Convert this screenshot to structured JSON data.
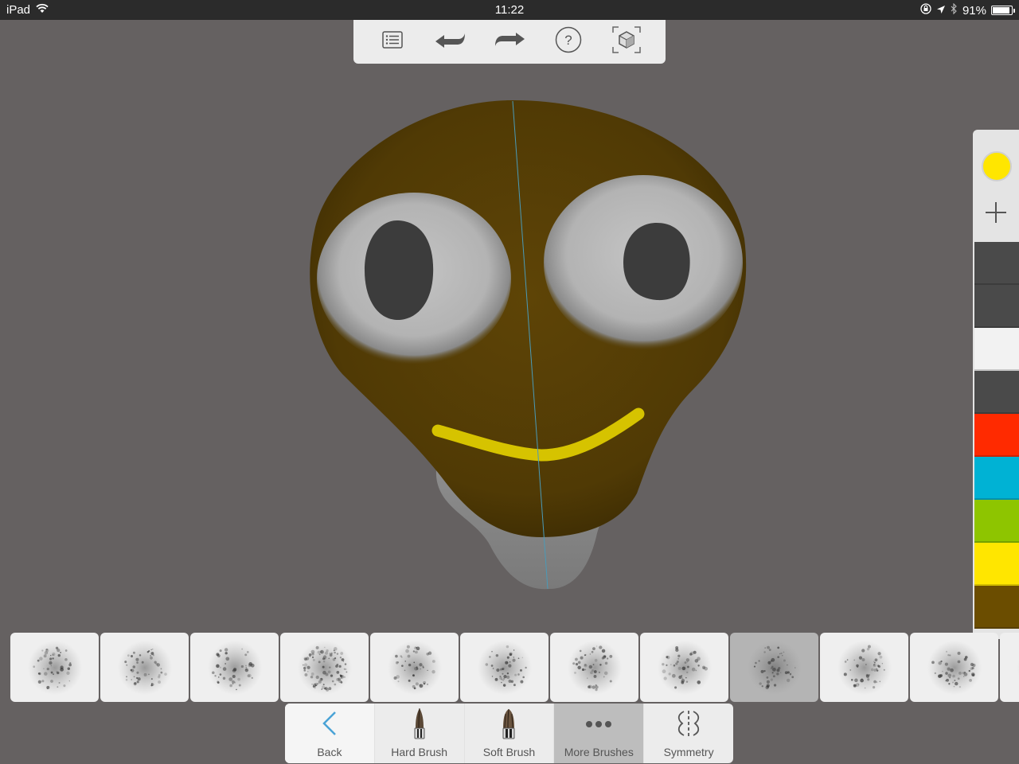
{
  "status_bar": {
    "device": "iPad",
    "time": "11:22",
    "battery_percent_label": "91%",
    "battery_level": 0.91
  },
  "top_toolbar": {
    "items": [
      {
        "name": "layers-list-button",
        "icon": "list-icon"
      },
      {
        "name": "undo-button",
        "icon": "undo-arrow-icon"
      },
      {
        "name": "redo-button",
        "icon": "redo-arrow-icon"
      },
      {
        "name": "help-button",
        "icon": "question-circle-icon"
      },
      {
        "name": "frame-model-button",
        "icon": "cube-frame-icon"
      }
    ]
  },
  "palette": {
    "current_color": "#ffe600",
    "add_icon": "plus-icon",
    "swatches": [
      "#4a4a4a",
      "#4a4a4a",
      "#f2f2f2",
      "#4a4a4a",
      "#ff2a00",
      "#00b2d4",
      "#8ec500",
      "#ffe600",
      "#6b4d00"
    ]
  },
  "brushes": {
    "count_visible": 11,
    "selected_index": 8
  },
  "bottom_toolbar": {
    "back": "Back",
    "hard_brush": "Hard Brush",
    "soft_brush": "Soft Brush",
    "more_brushes": "More Brushes",
    "symmetry": "Symmetry",
    "active": "More Brushes"
  },
  "colors": {
    "accent_blue": "#4aa3d6",
    "model_skin": "#5a4106",
    "smile": "#d4c000",
    "background": "#656161"
  }
}
